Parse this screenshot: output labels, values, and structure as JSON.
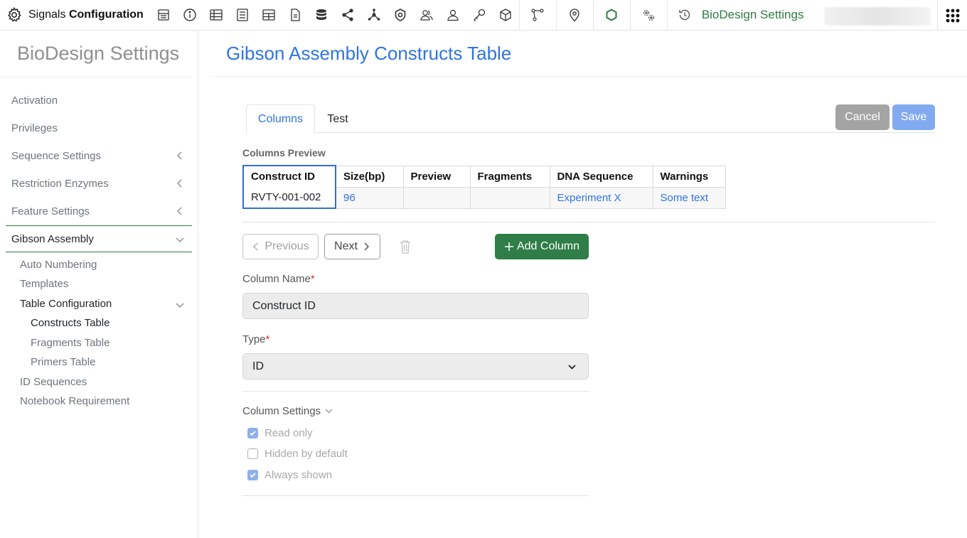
{
  "app": {
    "brand_light": "Signals",
    "brand_bold": "Configuration",
    "top_title": "BioDesign Settings",
    "accent_green": "#2e7d42",
    "accent_blue": "#2f74e0",
    "top_icons": [
      "layout-icon",
      "info-icon",
      "grid-icon",
      "document-list-icon",
      "table-icon",
      "file-icon",
      "database-icon",
      "share-icon",
      "network-icon",
      "shield-icon",
      "users-icon",
      "user-icon",
      "key-icon",
      "cube-icon",
      "path-icon",
      "location-pin-icon",
      "molecule-icon",
      "settings-gears-icon",
      "history-icon"
    ]
  },
  "sidebar": {
    "title": "BioDesign Settings",
    "items": [
      {
        "label": "Activation"
      },
      {
        "label": "Privileges"
      },
      {
        "label": "Sequence Settings"
      },
      {
        "label": "Restriction Enzymes"
      },
      {
        "label": "Feature Settings"
      },
      {
        "label": "Gibson Assembly"
      }
    ],
    "sub_items": [
      {
        "label": "Auto Numbering"
      },
      {
        "label": "Templates"
      },
      {
        "label": "Table Configuration"
      },
      {
        "label": "ID Sequences"
      },
      {
        "label": "Notebook Requirement"
      }
    ],
    "subsub_items": [
      {
        "label": "Constructs Table"
      },
      {
        "label": "Fragments Table"
      },
      {
        "label": "Primers Table"
      }
    ]
  },
  "main": {
    "title": "Gibson Assembly Constructs Table",
    "tabs": [
      {
        "label": "Columns"
      },
      {
        "label": "Test"
      }
    ],
    "cancel_label": "Cancel",
    "save_label": "Save",
    "preview_label": "Columns Preview",
    "preview_headers": [
      "Construct ID",
      "Size(bp)",
      "Preview",
      "Fragments",
      "DNA Sequence",
      "Warnings"
    ],
    "preview_row": [
      "RVTY-001-002",
      "96",
      "",
      "",
      "Experiment X",
      "Some text"
    ],
    "previous_label": "Previous",
    "next_label": "Next",
    "add_column_label": "Add Column",
    "column_name_label": "Column Name",
    "column_name_value": "Construct ID",
    "type_label": "Type",
    "type_value": "ID",
    "required_mark": "*",
    "settings_label": "Column Settings",
    "checkboxes": [
      {
        "label": "Read only",
        "checked": true
      },
      {
        "label": "Hidden by default",
        "checked": false
      },
      {
        "label": "Always shown",
        "checked": true
      }
    ]
  }
}
